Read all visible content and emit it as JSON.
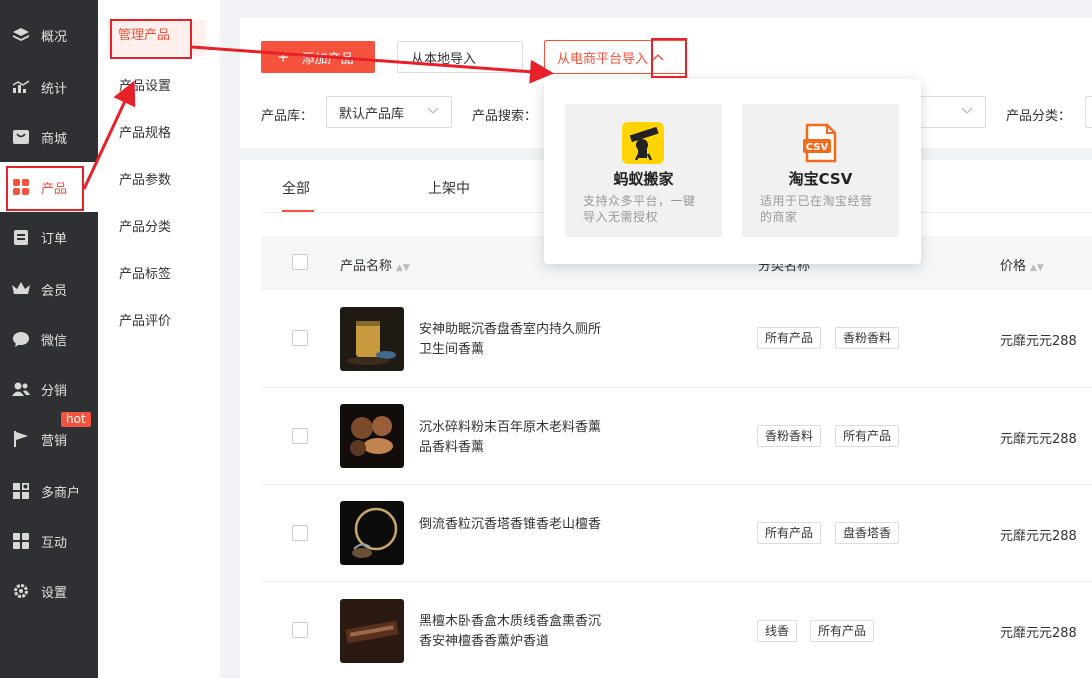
{
  "sidebar": {
    "items": [
      {
        "label": "概况",
        "icon": "diamond-icon"
      },
      {
        "label": "统计",
        "icon": "chart-icon"
      },
      {
        "label": "商城",
        "icon": "shop-icon"
      },
      {
        "label": "产品",
        "icon": "grid-icon"
      },
      {
        "label": "订单",
        "icon": "clipboard-icon"
      },
      {
        "label": "会员",
        "icon": "crown-icon"
      },
      {
        "label": "微信",
        "icon": "chat-icon"
      },
      {
        "label": "分销",
        "icon": "users-icon"
      },
      {
        "label": "营销",
        "icon": "flag-icon"
      },
      {
        "label": "多商户",
        "icon": "store-icon"
      },
      {
        "label": "互动",
        "icon": "apps-icon"
      },
      {
        "label": "设置",
        "icon": "gear-icon"
      }
    ],
    "hot_badge": "hot"
  },
  "submenu": {
    "items": [
      "管理产品",
      "产品设置",
      "产品规格",
      "产品参数",
      "产品分类",
      "产品标签",
      "产品评价"
    ]
  },
  "toolbar": {
    "add_label": "添加产品",
    "local_import_label": "从本地导入",
    "ecom_import_label": "从电商平台导入"
  },
  "filters": {
    "library_label": "产品库：",
    "library_value": "默认产品库",
    "search_label": "产品搜索：",
    "category_label": "产品分类："
  },
  "import_popup": {
    "cards": [
      {
        "name": "蚂蚁搬家",
        "desc": "支持众多平台，一键导入无需授权"
      },
      {
        "name": "淘宝CSV",
        "desc": "适用于已在淘宝经营的商家",
        "logo_text": "CSV"
      }
    ]
  },
  "tabs": [
    "全部",
    "上架中"
  ],
  "table": {
    "headers": {
      "name": "产品名称",
      "category": "分类名称",
      "price": "价格"
    },
    "rows": [
      {
        "name": "安神助眠沉香盘香室内持久厕所卫生间香薰",
        "tags": [
          "所有产品",
          "香粉香料"
        ],
        "price": "元靡元元288"
      },
      {
        "name": "沉水碎料粉末百年原木老料香薰品香料香薰",
        "tags": [
          "香粉香料",
          "所有产品"
        ],
        "price": "元靡元元288"
      },
      {
        "name": "倒流香粒沉香塔香锥香老山檀香",
        "tags": [
          "所有产品",
          "盘香塔香"
        ],
        "price": "元靡元元288"
      },
      {
        "name": "黑檀木卧香盒木质线香盒熏香沉香安神檀香香薰炉香道",
        "tags": [
          "线香",
          "所有产品"
        ],
        "price": "元靡元元288"
      }
    ]
  },
  "colors": {
    "accent": "#f5533d",
    "sidebar_bg": "#2f3033",
    "annotation": "#e8202a"
  }
}
